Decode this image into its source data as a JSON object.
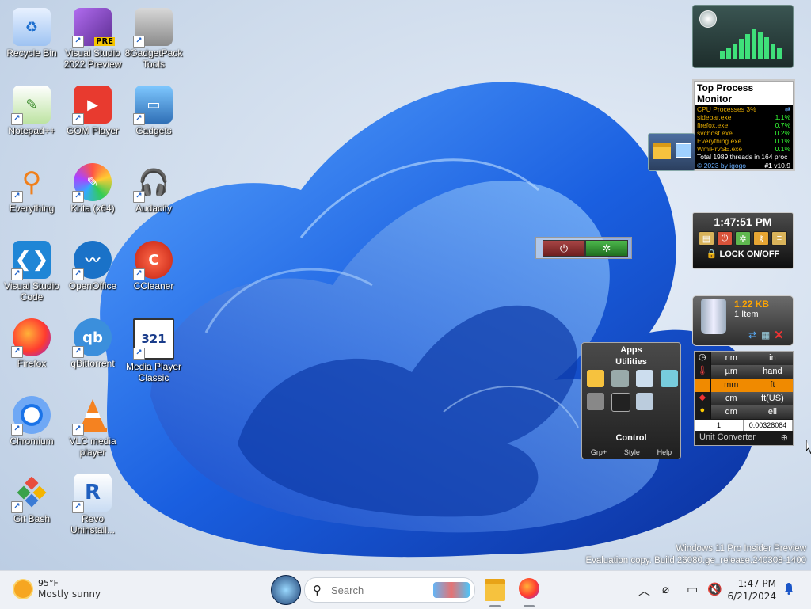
{
  "desktop": {
    "icons": [
      {
        "label": "Recycle Bin"
      },
      {
        "label": "Visual Studio 2022 Preview",
        "badge": "PRE"
      },
      {
        "label": "8GadgetPack Tools"
      },
      {
        "label": "Notepad++"
      },
      {
        "label": "GOM Player"
      },
      {
        "label": "Gadgets"
      },
      {
        "label": "Everything"
      },
      {
        "label": "Krita (x64)"
      },
      {
        "label": "Audacity"
      },
      {
        "label": "Visual Studio Code"
      },
      {
        "label": "OpenOffice"
      },
      {
        "label": "CCleaner"
      },
      {
        "label": "Firefox"
      },
      {
        "label": "qBittorrent",
        "glyph": "qb"
      },
      {
        "label": "Media Player Classic",
        "glyph": "321"
      },
      {
        "label": "Chromium"
      },
      {
        "label": "VLC media player"
      },
      {
        "label": "Git Bash"
      },
      {
        "label": "Revo Uninstall..."
      }
    ]
  },
  "gadgets": {
    "top_process": {
      "title": "Top Process Monitor",
      "header_label": "CPU Processes 3%",
      "rows": [
        {
          "name": "sidebar.exe",
          "value": "1.1%"
        },
        {
          "name": "firefox.exe",
          "value": "0.7%"
        },
        {
          "name": "svchost.exe",
          "value": "0.2%"
        },
        {
          "name": "Everything.exe",
          "value": "0.1%"
        },
        {
          "name": "WmiPrvSE.exe",
          "value": "0.1%"
        }
      ],
      "footer": "Total 1989 threads in 164 proc",
      "credit": "© 2023 by igogo",
      "rank": "#1",
      "version": "v10.9"
    },
    "clock": {
      "time": "1:47:51 PM",
      "lock_label": "LOCK ON/OFF"
    },
    "recycle": {
      "size": "1.22 KB",
      "items": "1 Item"
    },
    "apps": {
      "title": "Apps",
      "section": "Utilities",
      "control": "Control",
      "footer": [
        "Grp+",
        "Style",
        "Help"
      ]
    },
    "unit_converter": {
      "rows": [
        {
          "left": "nm",
          "right": "in"
        },
        {
          "left": "µm",
          "right": "hand"
        },
        {
          "left": "mm",
          "right": "ft"
        },
        {
          "left": "cm",
          "right": "ft(US)"
        },
        {
          "left": "dm",
          "right": "ell"
        }
      ],
      "input_value": "1",
      "output_value": "0.00328084",
      "label": "Unit Converter"
    }
  },
  "watermark": {
    "line1": "Windows 11 Pro Insider Preview",
    "line2": "Evaluation copy. Build 26080.ge_release.240308-1400"
  },
  "taskbar": {
    "weather_temp": "95°F",
    "weather_desc": "Mostly sunny",
    "search_placeholder": "Search",
    "time": "1:47 PM",
    "date": "6/21/2024"
  }
}
